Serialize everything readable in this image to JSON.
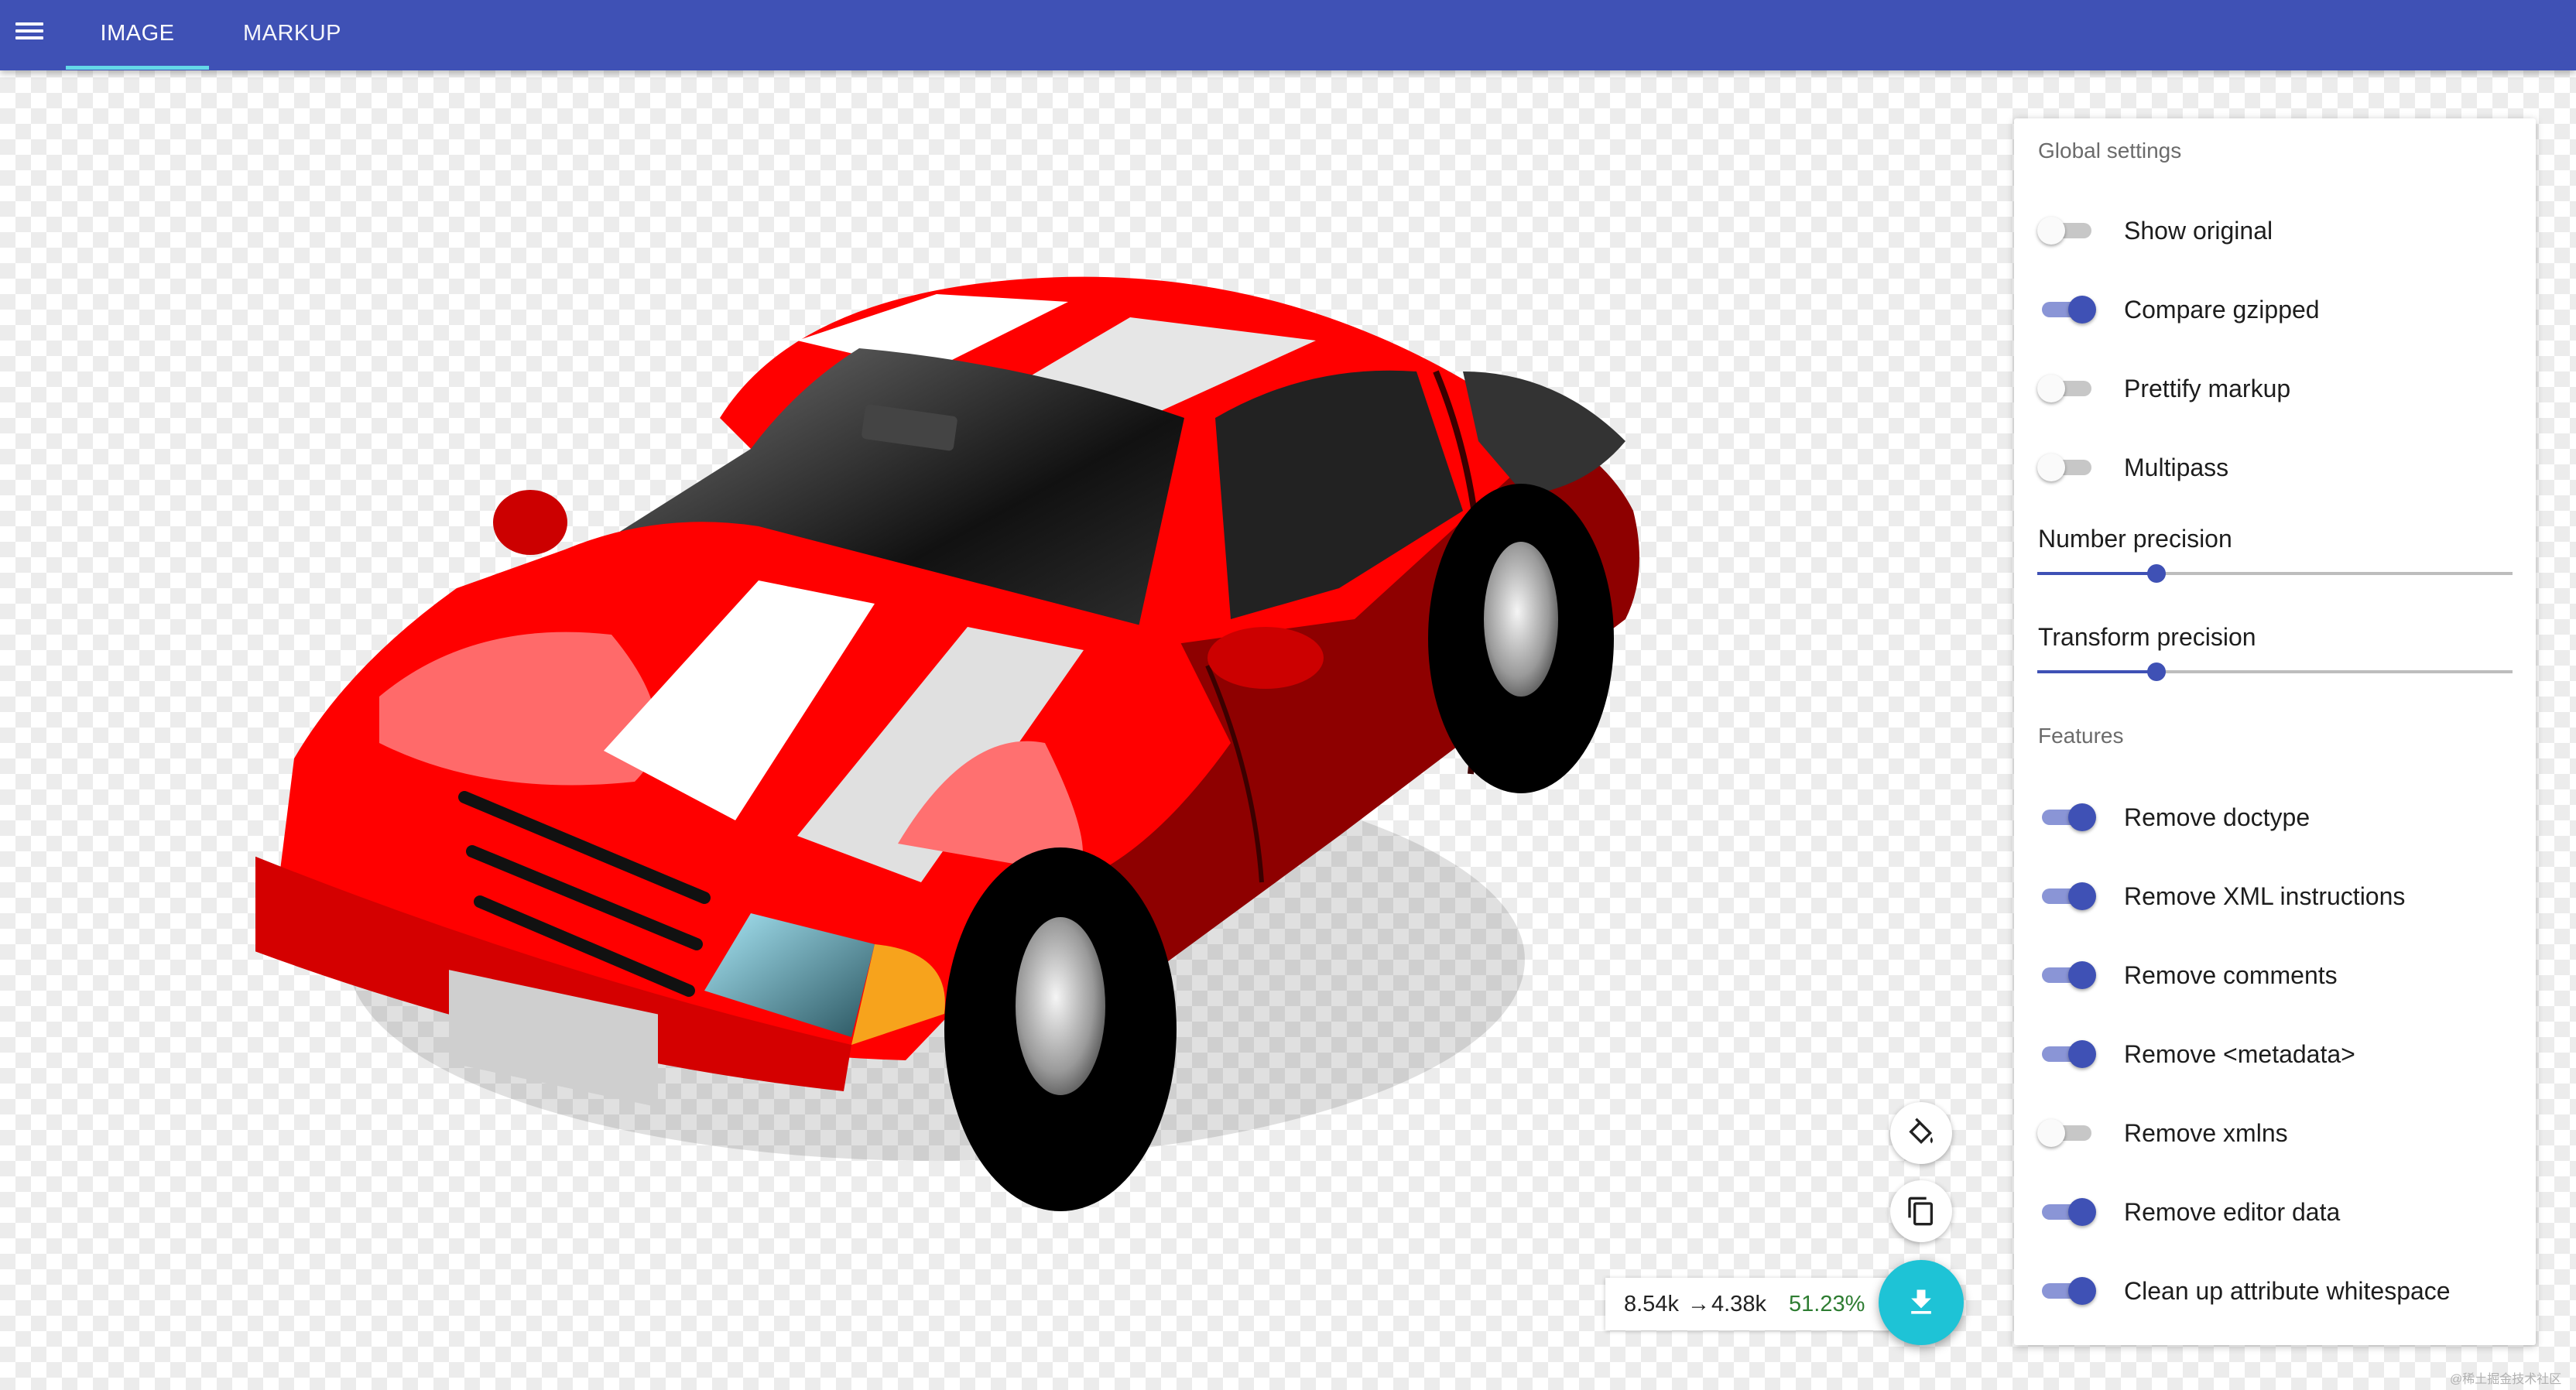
{
  "header": {
    "menu_icon": "hamburger-menu-icon",
    "tabs": [
      {
        "label": "IMAGE",
        "active": true
      },
      {
        "label": "MARKUP",
        "active": false
      }
    ],
    "accent_color": "#3f51b5",
    "indicator_color": "#64d8e8"
  },
  "preview": {
    "image_subject": "red sports car with white racing stripes"
  },
  "settings": {
    "global_title": "Global settings",
    "global_toggles": [
      {
        "label": "Show original",
        "on": false
      },
      {
        "label": "Compare gzipped",
        "on": true
      },
      {
        "label": "Prettify markup",
        "on": false
      },
      {
        "label": "Multipass",
        "on": false
      }
    ],
    "sliders": [
      {
        "label": "Number precision",
        "value_fraction": 0.25
      },
      {
        "label": "Transform precision",
        "value_fraction": 0.25
      }
    ],
    "features_title": "Features",
    "feature_toggles": [
      {
        "label": "Remove doctype",
        "on": true
      },
      {
        "label": "Remove XML instructions",
        "on": true
      },
      {
        "label": "Remove comments",
        "on": true
      },
      {
        "label": "Remove <metadata>",
        "on": true
      },
      {
        "label": "Remove xmlns",
        "on": false
      },
      {
        "label": "Remove editor data",
        "on": true
      },
      {
        "label": "Clean up attribute whitespace",
        "on": true
      }
    ]
  },
  "actions": {
    "background_icon": "paint-bucket-icon",
    "copy_icon": "copy-icon",
    "download_icon": "download-icon",
    "download_color": "#1ec3d6"
  },
  "result": {
    "original_size": "8.54k",
    "arrow": "→",
    "optimized_size": "4.38k",
    "savings": "51.23%",
    "savings_color": "#2e7d32"
  },
  "watermark": "@稀土掘金技术社区"
}
